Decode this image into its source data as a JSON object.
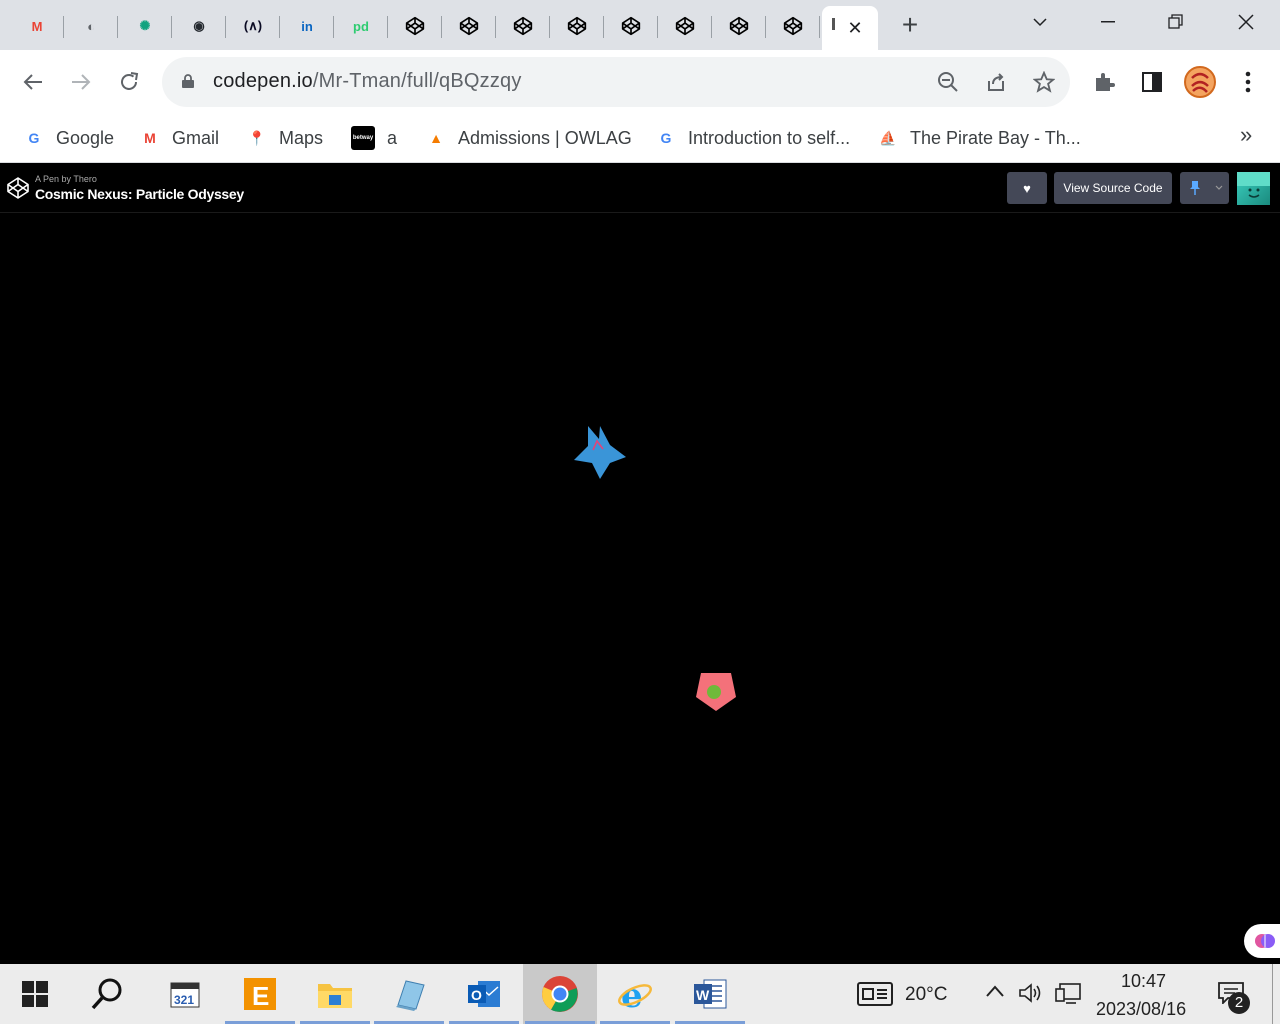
{
  "browser": {
    "tabs": [
      {
        "icon": "gmail-icon",
        "label": "M",
        "color": "#ea4335"
      },
      {
        "icon": "globe-icon",
        "label": "◐",
        "color": "#5f6368"
      },
      {
        "icon": "chatgpt-icon",
        "label": "✺",
        "color": "#10a37f"
      },
      {
        "icon": "github-icon",
        "label": "◉",
        "color": "#24292f"
      },
      {
        "icon": "freecodecamp-icon",
        "label": "(∧)",
        "color": "#0a0a23"
      },
      {
        "icon": "linkedin-icon",
        "label": "in",
        "color": "#0a66c2"
      },
      {
        "icon": "pd-icon",
        "label": "pd",
        "color": "#2ecc71"
      },
      {
        "icon": "codepen-icon",
        "label": "",
        "color": "#000000"
      },
      {
        "icon": "codepen-icon",
        "label": "",
        "color": "#000000"
      },
      {
        "icon": "codepen-icon",
        "label": "",
        "color": "#000000"
      },
      {
        "icon": "codepen-icon",
        "label": "",
        "color": "#000000"
      },
      {
        "icon": "codepen-icon",
        "label": "",
        "color": "#000000"
      },
      {
        "icon": "codepen-icon",
        "label": "",
        "color": "#000000"
      },
      {
        "icon": "codepen-icon",
        "label": "",
        "color": "#000000"
      },
      {
        "icon": "codepen-icon",
        "label": "",
        "color": "#000000"
      }
    ],
    "active_tab_close": "✕",
    "new_tab": "+",
    "url_host": "codepen.io",
    "url_path": "/Mr-Tman/full/qBQzzqy"
  },
  "bookmarks": [
    {
      "label": "Google",
      "icon": "google-icon",
      "glyph": "G",
      "color": "#4285f4"
    },
    {
      "label": "Gmail",
      "icon": "gmail-icon",
      "glyph": "M",
      "color": "#ea4335"
    },
    {
      "label": "Maps",
      "icon": "maps-pin-icon",
      "glyph": "📍",
      "color": "#34a853"
    },
    {
      "label": "a",
      "icon": "betway-icon",
      "glyph": "betway",
      "color": "#000000"
    },
    {
      "label": "Admissions | OWLAG",
      "icon": "owlag-icon",
      "glyph": "▲",
      "color": "#f57c00"
    },
    {
      "label": "Introduction to self...",
      "icon": "google-icon",
      "glyph": "G",
      "color": "#4285f4"
    },
    {
      "label": "The Pirate Bay - Th...",
      "icon": "pirate-ship-icon",
      "glyph": "⛵",
      "color": "#333333"
    }
  ],
  "bookmarks_more": "»",
  "codepen": {
    "by_line": "A Pen by Thero",
    "title": "Cosmic Nexus: Particle Odyssey",
    "view_source": "View Source Code",
    "heart": "♥"
  },
  "canvas_shapes": [
    {
      "name": "blue-star-particle",
      "color": "#3a95d8"
    },
    {
      "name": "pink-pentagon-particle",
      "color": "#f4717a",
      "inner": "#6fba3a"
    }
  ],
  "taskbar": {
    "weather_temp": "20°C",
    "time": "10:47",
    "date": "2023/08/16",
    "notifications": "2",
    "apps": [
      {
        "name": "start-icon"
      },
      {
        "name": "search-icon"
      },
      {
        "name": "media-player-icon"
      },
      {
        "name": "e-app-icon"
      },
      {
        "name": "file-explorer-icon"
      },
      {
        "name": "notepad-icon"
      },
      {
        "name": "outlook-icon"
      },
      {
        "name": "chrome-icon"
      },
      {
        "name": "ie-icon"
      },
      {
        "name": "word-icon"
      }
    ]
  }
}
